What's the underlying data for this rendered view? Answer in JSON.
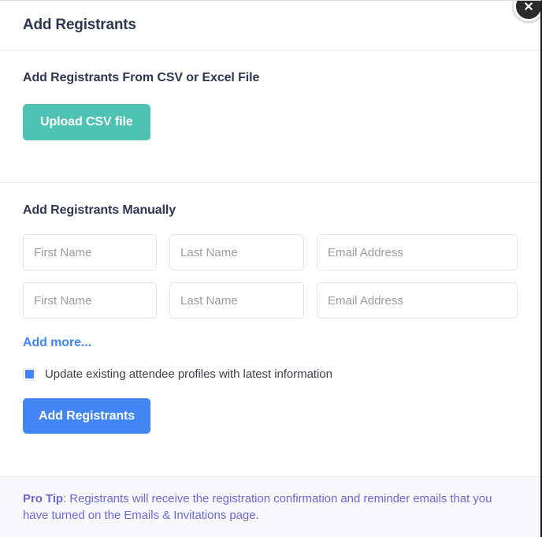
{
  "modal": {
    "title": "Add Registrants",
    "close_icon": "close-circle-icon"
  },
  "csv_section": {
    "heading": "Add Registrants From CSV or Excel File",
    "upload_button": "Upload CSV file",
    "upload_button_color": "#4ec3b3"
  },
  "manual_section": {
    "heading": "Add Registrants Manually",
    "rows": [
      {
        "first_name_placeholder": "First Name",
        "first_name_value": "",
        "last_name_placeholder": "Last Name",
        "last_name_value": "",
        "email_placeholder": "Email Address",
        "email_value": ""
      },
      {
        "first_name_placeholder": "First Name",
        "first_name_value": "",
        "last_name_placeholder": "Last Name",
        "last_name_value": "",
        "email_placeholder": "Email Address",
        "email_value": ""
      }
    ],
    "add_more_label": "Add more...",
    "add_more_color": "#4285f4",
    "checkbox": {
      "label": "Update existing attendee profiles with latest information",
      "checked": true,
      "checked_color": "#4285f4"
    },
    "submit_button": "Add Registrants",
    "submit_button_color": "#4285f4"
  },
  "pro_tip": {
    "label": "Pro Tip",
    "separator": ": ",
    "text": "Registrants will receive the registration confirmation and reminder emails that you have turned on the Emails & Invitations page.",
    "text_color": "#6d68d2",
    "background_color": "#f8f8fd"
  }
}
